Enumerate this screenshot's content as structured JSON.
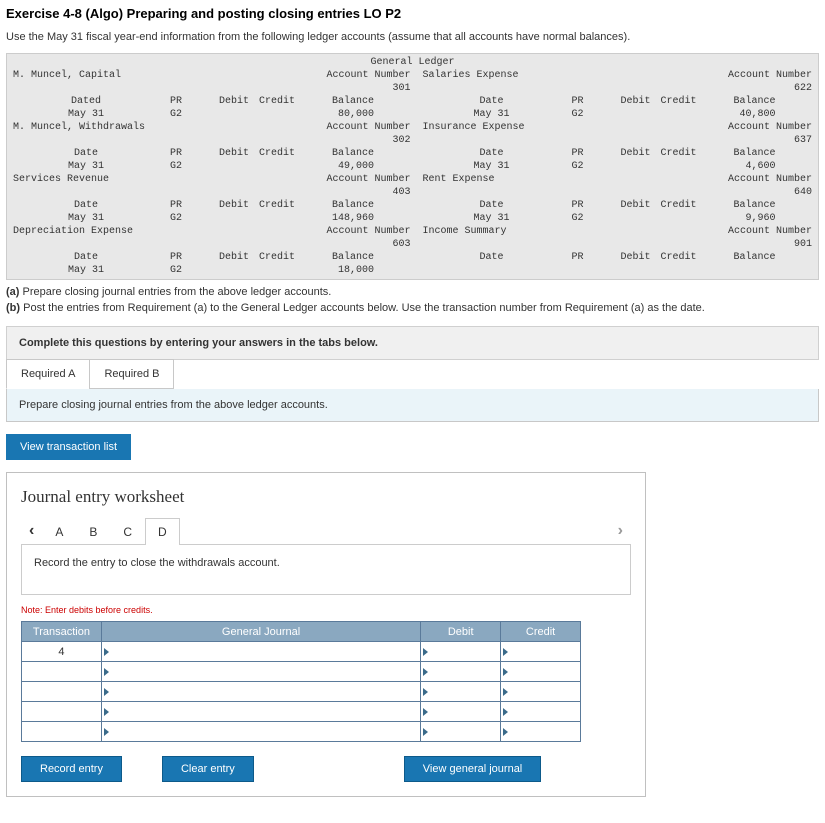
{
  "title": "Exercise 4-8 (Algo) Preparing and posting closing entries LO P2",
  "instructions": "Use the May 31 fiscal year-end information from the following ledger accounts (assume that all accounts have normal balances).",
  "ledger_header": "General Ledger",
  "col_labels": {
    "date": "Date",
    "dated": "Dated",
    "pr": "PR",
    "debit": "Debit",
    "credit": "Credit",
    "balance": "Balance"
  },
  "acct_num_prefix": "Account Number",
  "ledger": {
    "left": [
      {
        "name": "M. Muncel, Capital",
        "acct": "301",
        "rows": [
          {
            "date": "May 31",
            "pr": "G2",
            "bal": "80,000"
          }
        ]
      },
      {
        "name": "M. Muncel, Withdrawals",
        "acct": "302",
        "rows": [
          {
            "date": "May 31",
            "pr": "G2",
            "bal": "49,000"
          }
        ]
      },
      {
        "name": "Services Revenue",
        "acct": "403",
        "rows": [
          {
            "date": "May 31",
            "pr": "G2",
            "bal": "148,960"
          }
        ]
      },
      {
        "name": "Depreciation Expense",
        "acct": "603",
        "rows": [
          {
            "date": "May 31",
            "pr": "G2",
            "bal": "18,000"
          }
        ]
      }
    ],
    "right": [
      {
        "name": "Salaries Expense",
        "acct": "622",
        "rows": [
          {
            "date": "May 31",
            "pr": "G2",
            "bal": "40,800"
          }
        ]
      },
      {
        "name": "Insurance Expense",
        "acct": "637",
        "rows": [
          {
            "date": "May 31",
            "pr": "G2",
            "bal": "4,600"
          }
        ]
      },
      {
        "name": "Rent Expense",
        "acct": "640",
        "rows": [
          {
            "date": "May 31",
            "pr": "G2",
            "bal": "9,960"
          }
        ]
      },
      {
        "name": "Income Summary",
        "acct": "901",
        "rows": [
          {
            "date": "",
            "pr": "",
            "bal": ""
          }
        ]
      }
    ]
  },
  "part_a_label": "(a)",
  "part_a_text": "Prepare closing journal entries from the above ledger accounts.",
  "part_b_label": "(b)",
  "part_b_text": "Post the entries from Requirement (a) to the General Ledger accounts below. Use the transaction number from Requirement (a) as the date.",
  "answer_box": "Complete this questions by entering your answers in the tabs below.",
  "tabs": {
    "a": "Required A",
    "b": "Required B"
  },
  "tab_pane_text": "Prepare closing journal entries from the above ledger accounts.",
  "view_txn_btn": "View transaction list",
  "worksheet": {
    "title": "Journal entry worksheet",
    "nav": [
      "A",
      "B",
      "C",
      "D"
    ],
    "active_nav": "D",
    "instruction": "Record the entry to close the withdrawals account.",
    "note": "Note: Enter debits before credits.",
    "headers": {
      "transaction": "Transaction",
      "general": "General Journal",
      "debit": "Debit",
      "credit": "Credit"
    },
    "transaction_no": "4",
    "buttons": {
      "record": "Record entry",
      "clear": "Clear entry",
      "view": "View general journal"
    }
  }
}
